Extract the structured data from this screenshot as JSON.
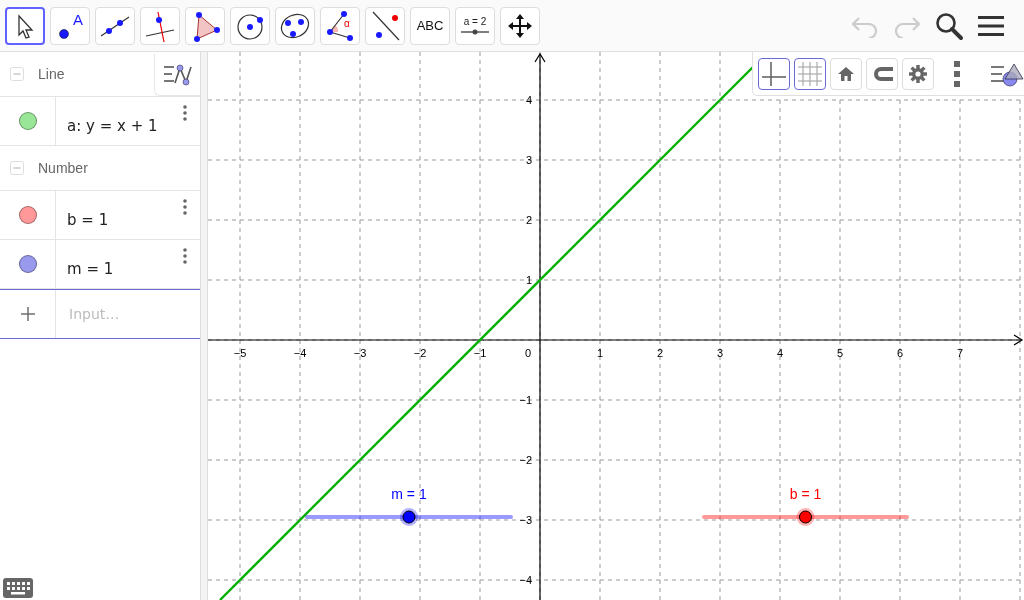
{
  "toolbar": {
    "tools": [
      {
        "kind": "move",
        "selected": true
      },
      {
        "kind": "point",
        "label": "A",
        "selected": false
      },
      {
        "kind": "line",
        "selected": false
      },
      {
        "kind": "perpendicular",
        "selected": false
      },
      {
        "kind": "polygon",
        "selected": false
      },
      {
        "kind": "circle",
        "selected": false
      },
      {
        "kind": "conic",
        "selected": false
      },
      {
        "kind": "angle",
        "label": "α",
        "selected": false
      },
      {
        "kind": "reflect",
        "selected": false
      },
      {
        "kind": "text",
        "label": "ABC",
        "selected": false
      },
      {
        "kind": "slider",
        "label": "a = 2",
        "selected": false
      },
      {
        "kind": "pan",
        "selected": false
      }
    ],
    "undo": {
      "disabled": true
    },
    "redo": {
      "disabled": true
    }
  },
  "algebra": {
    "groups": [
      {
        "title": "Line",
        "expanded": true,
        "items": [
          {
            "expression": "a: y = x + 1",
            "color": "#99e699"
          }
        ]
      },
      {
        "title": "Number",
        "expanded": true,
        "items": [
          {
            "expression": "b = 1",
            "color": "#ff9999"
          },
          {
            "expression": "m = 1",
            "color": "#9999ee"
          }
        ]
      }
    ],
    "input": {
      "placeholder": "Input…"
    }
  },
  "graphics": {
    "style_bar": [
      {
        "kind": "axes",
        "selected": true
      },
      {
        "kind": "grid",
        "selected": true
      },
      {
        "kind": "home",
        "selected": false
      },
      {
        "kind": "snap",
        "selected": false
      },
      {
        "kind": "settings",
        "selected": false
      }
    ],
    "x_labels": [
      "−5",
      "−4",
      "−3",
      "−2",
      "−1",
      "1",
      "2",
      "3",
      "4",
      "5",
      "6",
      "7"
    ],
    "origin_label": "0",
    "y_labels": [
      "4",
      "3",
      "2",
      "1",
      "−1",
      "−2",
      "−3",
      "−4"
    ],
    "sliders": [
      {
        "label": "m = 1",
        "color": "#0000ff",
        "level": 0.5
      },
      {
        "label": "b = 1",
        "color": "#ff0000",
        "level": 0.5
      }
    ]
  }
}
